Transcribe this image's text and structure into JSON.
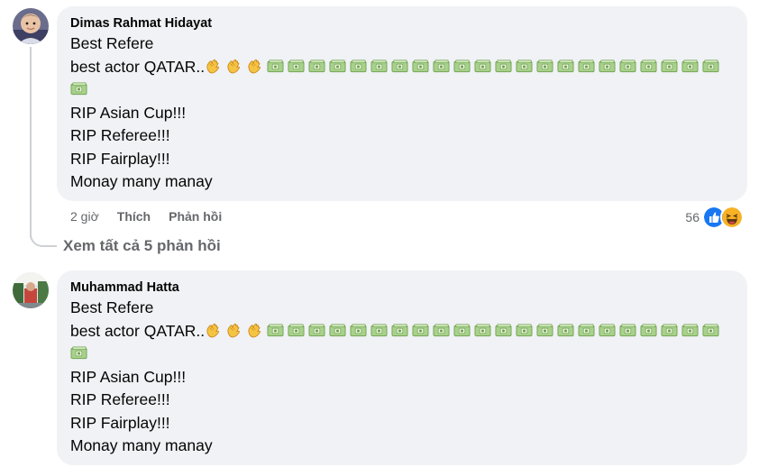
{
  "comments": [
    {
      "author": "Dimas Rahmat Hidayat",
      "line1": "Best Refere",
      "line2_text": "best actor QATAR..",
      "line3": "RIP Asian Cup!!!",
      "line4": "RIP Referee!!!",
      "line5": "RIP Fairplay!!!",
      "line6": "Monay many manay",
      "clap_count": 3,
      "money_count_row1": 22,
      "money_count_row2": 1,
      "time": "2 giờ",
      "like_label": "Thích",
      "reply_label": "Phản hồi",
      "reaction_count": "56",
      "reaction_icons": [
        "like-icon",
        "haha-icon"
      ]
    },
    {
      "author": "Muhammad Hatta",
      "line1": "Best Refere",
      "line2_text": "best actor QATAR..",
      "line3": "RIP Asian Cup!!!",
      "line4": "RIP Referee!!!",
      "line5": "RIP Fairplay!!!",
      "line6": "Monay many manay",
      "clap_count": 3,
      "money_count_row1": 22,
      "money_count_row2": 1
    }
  ],
  "view_replies": "Xem tất cả 5 phản hồi",
  "colors": {
    "bubble": "#f0f2f5",
    "secondary_text": "#65676b",
    "like_blue": "#1877f2",
    "haha_yellow": "#f7b125"
  }
}
